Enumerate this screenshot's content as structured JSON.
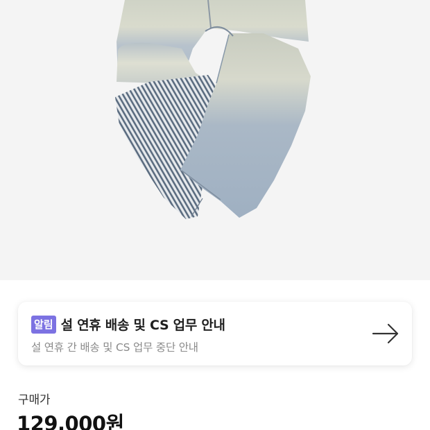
{
  "product": {
    "image_alt": "jeans-product-photo",
    "image_background": "#f4f4f4"
  },
  "notice": {
    "badge_label": "알림",
    "badge_color": "#7c72e2",
    "title": "설 연휴 배송 및 CS 업무 안내",
    "subtitle": "설 연휴 간 배송 및 CS 업무 중단 안내",
    "action_icon": "arrow-right-icon"
  },
  "price": {
    "label": "구매가",
    "value": "129,000원"
  }
}
